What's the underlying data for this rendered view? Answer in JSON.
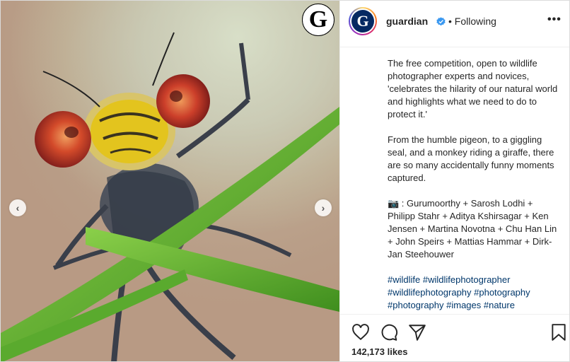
{
  "post": {
    "image_alt": "Close-up of a damselfly on grass stems",
    "logo_letter": "G"
  },
  "carousel": {
    "prev_glyph": "‹",
    "next_glyph": "›"
  },
  "header": {
    "avatar_letter": "G",
    "username": "guardian",
    "separator_following": "• Following",
    "more_glyph": "•••"
  },
  "caption": {
    "paragraph1": "The free competition, open to wildlife photographer experts and novices, 'celebrates the hilarity of our natural world and highlights what we need to do to protect it.'",
    "paragraph2": "From the humble pigeon, to a giggling seal, and a monkey riding a giraffe, there are so many accidentally funny moments captured.",
    "paragraph3": "📷 : Gurumoorthy + Sarosh Lodhi + Philipp Stahr + Aditya Kshirsagar + Ken Jensen + Martina Novotna + Chu Han Lin + John Speirs + Mattias Hammar + Dirk-Jan Steehouwer",
    "hashtags": "#wildlife #wildlifephotographer #wildlifephotography #photography #photography #images #nature"
  },
  "actions": {
    "likes_text": "142,173 likes"
  },
  "colors": {
    "verified": "#3897f0",
    "hashtag": "#00376b",
    "guardian_blue": "#052962"
  }
}
